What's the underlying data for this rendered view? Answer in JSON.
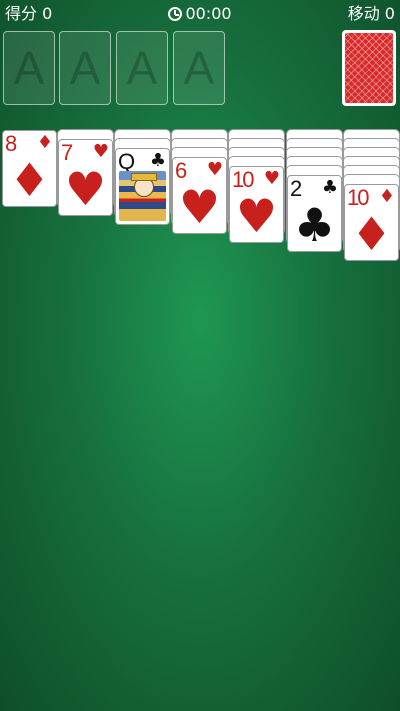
{
  "header": {
    "score_label": "得分 0",
    "timer": "00:00",
    "moves_label": "移动 0"
  },
  "foundations": [
    {
      "label": "A"
    },
    {
      "label": "A"
    },
    {
      "label": "A"
    },
    {
      "label": "A"
    }
  ],
  "stock": {
    "icon": "card-back-pattern"
  },
  "tableau": [
    {
      "hidden": 0,
      "card": {
        "rank": "8",
        "suit": "♦",
        "color": "red"
      }
    },
    {
      "hidden": 1,
      "card": {
        "rank": "7",
        "suit": "♥",
        "color": "red"
      }
    },
    {
      "hidden": 2,
      "card": {
        "rank": "Q",
        "suit": "♣",
        "color": "black",
        "face": true
      }
    },
    {
      "hidden": 3,
      "card": {
        "rank": "6",
        "suit": "♥",
        "color": "red"
      }
    },
    {
      "hidden": 4,
      "card": {
        "rank": "10",
        "suit": "♥",
        "color": "red"
      }
    },
    {
      "hidden": 5,
      "card": {
        "rank": "2",
        "suit": "♣",
        "color": "black"
      }
    },
    {
      "hidden": 6,
      "card": {
        "rank": "10",
        "suit": "♦",
        "color": "red"
      }
    }
  ],
  "colors": {
    "red_suit": "#c8211d",
    "felt": "#1a7f45",
    "card_back": "#d92a2a"
  }
}
